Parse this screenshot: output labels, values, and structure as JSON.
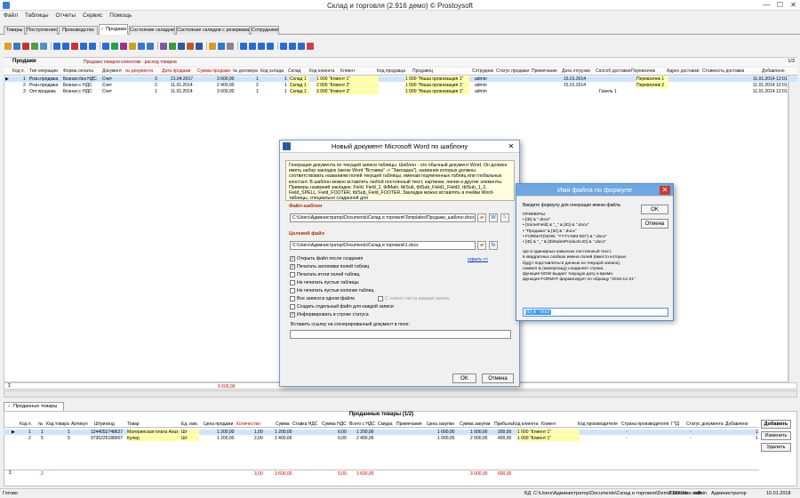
{
  "window": {
    "title": "Склад и торговля (2.916 демо) © Prostoysoft",
    "minimize": "—",
    "maximize": "☐",
    "close": "✕"
  },
  "menu": [
    "Файл",
    "Таблицы",
    "Отчеты",
    "Сервис",
    "Помощь"
  ],
  "tabs": [
    "Товары",
    "Поступления",
    "Производство",
    "Продажи",
    "Состояние складов",
    "Состояние складов с резервами",
    "Сотрудники"
  ],
  "active_tab": "Продажи",
  "main_grid": {
    "title": "Продажи",
    "subtitle": "Продажа товаров клиентам - расход товаров",
    "page": "1/3",
    "columns": [
      "Код п.",
      "Тип операции",
      "Форма оплаты",
      "Документ",
      "№ документа",
      "Дата продажи",
      "Сумма продажи",
      "№ договора",
      "Код склада",
      "Склад",
      "Код клиента",
      "Клиент",
      "Код продавца",
      "Продавец",
      "Сотрудник",
      "Статус продажи",
      "Примечание",
      "Дата отгрузки",
      "Способ доставки",
      "Перевозчик",
      "Адрес доставки",
      "Стоимость доставки",
      "Добавлено"
    ],
    "rows": [
      {
        "id": "1",
        "type": "Розн.продажа",
        "payment": "Безнал.без НДС",
        "doc": "Счет",
        "docno": "3",
        "date": "21.04.2017",
        "sum": "3 600,00",
        "contract": "1",
        "store_code": "1",
        "store": "Склад 1",
        "client_code": "1 000",
        "client": "\"Клиент 1\"",
        "seller_code": "1 000",
        "seller": "\"Наша организация 1\"",
        "employee": "admin",
        "ship_date": "15.01.2014",
        "carrier": "Перевозчик 1",
        "added": "11.01.2014 12:01"
      },
      {
        "id": "2",
        "type": "Розн.продажа",
        "payment": "Безнал.с НДС",
        "doc": "Счет",
        "docno": "2",
        "date": "11.01.2014",
        "sum": "2 400,00",
        "contract": "2",
        "store_code": "1",
        "store": "Склад 1",
        "client_code": "2 000",
        "client": "\"Клиент 2\"",
        "seller_code": "1 000",
        "seller": "\"Наша организация 1\"",
        "employee": "admin",
        "ship_date": "15.01.2014",
        "carrier": "Перевозчик 2",
        "added": "11.01.2014 12:01"
      },
      {
        "id": "3",
        "type": "Опт.продажа",
        "payment": "Безнал.с НДС",
        "doc": "Счет",
        "docno": "1",
        "date": "11.01.2014",
        "sum": "3 600,00",
        "contract": "1",
        "store_code": "1",
        "store": "Склад 1",
        "client_code": "3 000",
        "client": "\"Клиент 3\"",
        "seller_code": "1 000",
        "seller": "\"Наша организация 1\"",
        "employee": "admin",
        "ship_date": "",
        "carrier": "Газель 1",
        "added": "11.01.2014 12:01"
      }
    ],
    "total_sum": "9 600,00",
    "sigma": "Σ"
  },
  "sub_tab": "Проданные товары",
  "sub_grid": {
    "title": "Проданные товары (1/2)",
    "columns": [
      "Код п.",
      "№",
      "Код товара",
      "Артикул",
      "Штрихкод",
      "Товар",
      "Ед. изм.",
      "Цена продажи",
      "Количество",
      "Сумма",
      "Ставка НДС",
      "Сумма НДС",
      "Всего с НДС",
      "Скидка",
      "Примечание",
      "Цена закупки",
      "Сумма закупки",
      "Прибыль",
      "Код клиента",
      "Клиент",
      "Код производителя",
      "Страна производителя",
      "ГТД",
      "Статус документа",
      "Добавлено"
    ],
    "rows": [
      {
        "id": "1",
        "no": "1",
        "code": "1",
        "article": "1244052748627",
        "barcode": "",
        "item": "Материнская плата Asus",
        "unit": "Шт",
        "price": "1 200,00",
        "qty": "1,00",
        "sum": "1 200,00",
        "vat_sum": "0,00",
        "total": "1 200,00",
        "buy_price": "1 000,00",
        "buy_sum": "1 000,00",
        "profit": "200,00",
        "client_code": "1 000",
        "client": "\"Клиент 1\"",
        "maker": "-",
        "status": "-",
        "added": "1"
      },
      {
        "id": "2",
        "no": "5",
        "code": "5",
        "article": "9736225188907",
        "barcode": "",
        "item": "Кулер",
        "unit": "Шт",
        "price": "1 200,00",
        "qty": "2,00",
        "sum": "2 400,00",
        "vat_sum": "0,00",
        "total": "2 400,00",
        "buy_price": "1 000,00",
        "buy_sum": "2 000,00",
        "profit": "400,00",
        "client_code": "1 000",
        "client": "\"Клиент 1\"",
        "maker": "-",
        "status": "-",
        "added": "1"
      }
    ],
    "totals": {
      "count": "2",
      "qty": "3,00",
      "sum": "3 600,00",
      "vat": "0,00",
      "total": "3 600,00",
      "buy_sum": "3 000,00",
      "profit": "600,00"
    },
    "buttons": {
      "add": "Добавить",
      "edit": "Изменить",
      "delete": "Удалить"
    }
  },
  "statusbar": {
    "ready": "Готово",
    "db_label": "БД",
    "db_path": "C:\\Users\\Администратор\\Documents\\Склад и торговля\\DemoDatabase.mdb",
    "size": "2 896 Kb",
    "user": "admin",
    "role": "Администратор",
    "date": "10.01.2018"
  },
  "word_dialog": {
    "title": "Новый документ Microsoft Word по шаблону",
    "help": "Генерация документа по текущей записи таблицы. Шаблон - это обычный документ Word. Он должен иметь набор закладок (меню Word \"Вставка\" -> \"Закладка\"), названия которых должны соответствовать названиям полей текущей таблицы, именам подчиненных таблиц или глобальных констант. В шаблон можно вставлять любой постоянный текст, картинки, линии и другие элементы. Примеры названий закладок: Field, Field_2, tblMain, tblSub, tblSub_Field1_Field2, tblSub_1_2, Field_SPELL, Field_FOOTER, tblSub_Field_FOOTER. Закладки можно вставлять в ячейки Word-таблицы, специально созданной для",
    "template_label": "Файл-шаблон",
    "template_path": "C:\\Users\\Администратор\\Documents\\Склад и торговля\\Templates\\Продажи_шаблон.docx",
    "target_label": "Целевой файл",
    "target_path": "C:\\Users\\Администратор\\Documents\\Склад и торговля\\1.docx",
    "hide_link": "скрыть <<",
    "options": [
      {
        "label": "Открыть файл после создания",
        "checked": true
      },
      {
        "label": "Печатать заголовки полей таблиц",
        "checked": true
      },
      {
        "label": "Печатать итоги полей таблиц",
        "checked": false
      },
      {
        "label": "Не печатать пустые таблицы",
        "checked": false
      },
      {
        "label": "Не печатать пустые колонки таблиц",
        "checked": false
      },
      {
        "label": "Все записи в одном файле",
        "checked": false
      },
      {
        "label": "Создать отдельный файл для каждой записи",
        "checked": false
      },
      {
        "label": "Информировать в строке статуса",
        "checked": true
      }
    ],
    "page_break_label": "С нового листа каждая запись",
    "link_label": "Вставить ссылку на сгенерированный документ в поле:",
    "link_value": "",
    "ok": "OK",
    "cancel": "Отмена"
  },
  "formula_dialog": {
    "title": "Имя файла по формуле",
    "prompt": "Введите формулу для генерации имени файла",
    "examples": [
      "ПРИМЕРЫ:",
      "• [ID] & \".docx\"",
      "• [SomeField] & \"_\" & [ID] & \".docx\"",
      "• \"Продажа\" & [ID] & \".docx\"",
      "• FORMAT(NOW, \"YYYY-MM-DD\") & \".docx\"",
      "• [ID] & \"_\" & [tblSalesProducts.ID] & \".docx\"",
      "",
      "где в одинарных кавычках постоянный текст,",
      "в квадратных скобках имена полей (вместо которых",
      "будут подставляться данные из текущей записи),",
      "символ & (амперсанд) соединяет строки,",
      "функция NOW выдает текущую дату и время,",
      "функция FORMAT форматирует по образцу \"2018-12-31\""
    ],
    "formula": "[ID] & \".docx\"",
    "ok": "OK",
    "cancel": "Отмена"
  }
}
